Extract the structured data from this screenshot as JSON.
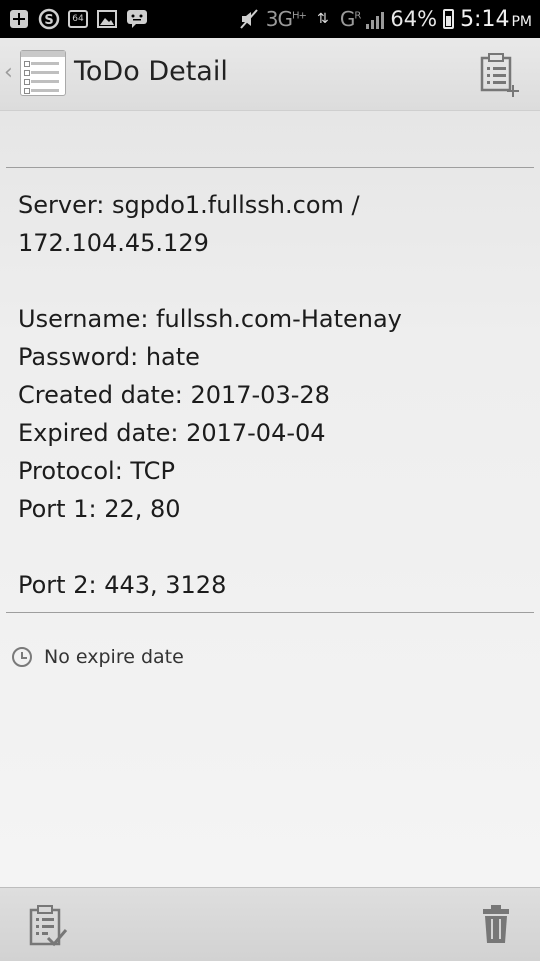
{
  "status_bar": {
    "left_badge": "64",
    "network_1": "3G",
    "network_1_sub": "H+",
    "network_2": "G",
    "network_2_sub": "R",
    "battery": "64%",
    "time": "5:14",
    "ampm": "PM"
  },
  "action_bar": {
    "title": "ToDo Detail"
  },
  "details": {
    "server_line1": "Server: sgpdo1.fullssh.com /",
    "server_line2": "172.104.45.129",
    "username": "Username: fullssh.com-Hatenay",
    "password": "Password: hate",
    "created": "Created date: 2017-03-28",
    "expired": "Expired date: 2017-04-04",
    "protocol": "Protocol: TCP",
    "port1": "Port 1: 22, 80",
    "port2": "Port 2: 443, 3128"
  },
  "expire": {
    "label": "No expire date"
  },
  "icons": {
    "add": "add-todo-icon",
    "done": "checklist-icon",
    "delete": "trash-icon",
    "clock": "clock-icon"
  }
}
